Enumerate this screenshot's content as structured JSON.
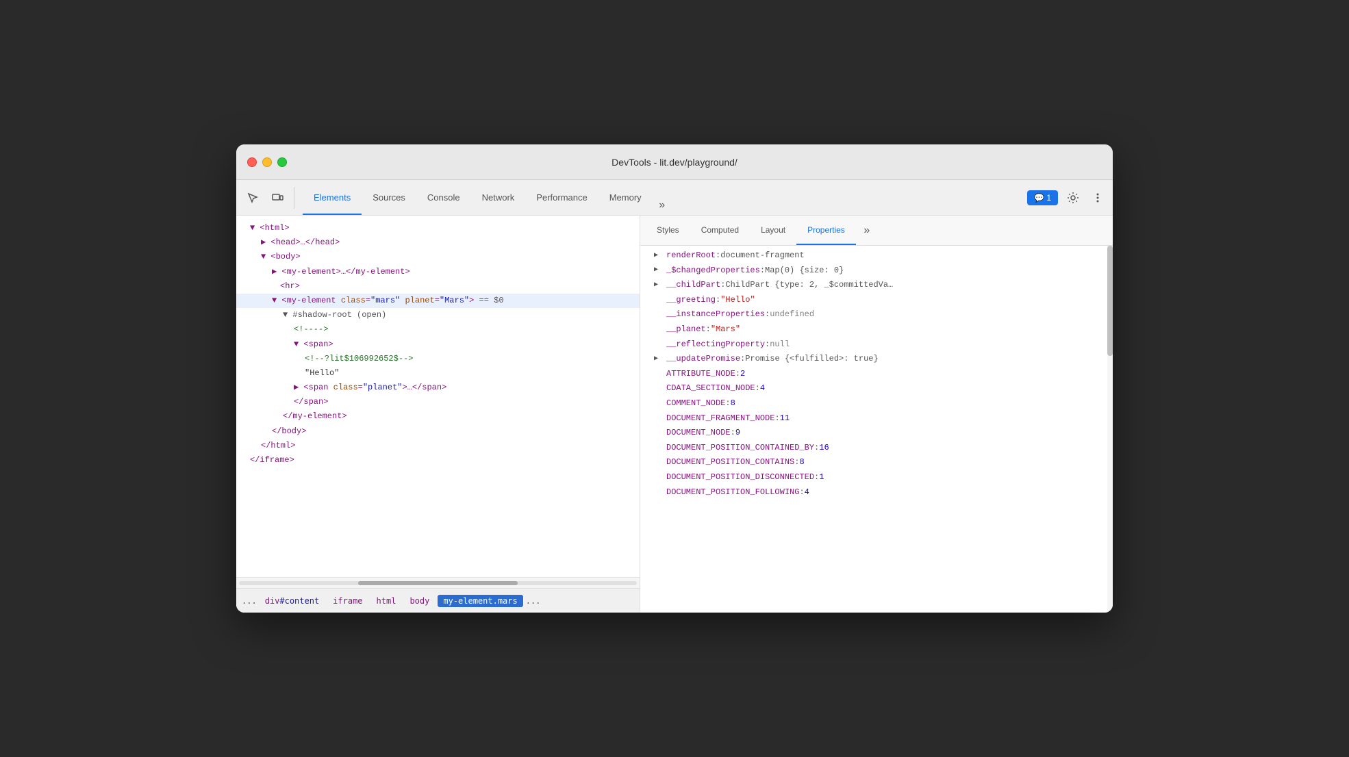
{
  "window": {
    "title": "DevTools - lit.dev/playground/"
  },
  "toolbar": {
    "tabs": [
      {
        "label": "Elements",
        "active": true
      },
      {
        "label": "Sources",
        "active": false
      },
      {
        "label": "Console",
        "active": false
      },
      {
        "label": "Network",
        "active": false
      },
      {
        "label": "Performance",
        "active": false
      },
      {
        "label": "Memory",
        "active": false
      }
    ],
    "more_tabs_label": "»",
    "notification_label": "💬 1",
    "settings_label": "⚙",
    "menu_label": "⋮"
  },
  "elements_panel": {
    "tree": [
      {
        "indent": 1,
        "content": "▼ <html>",
        "type": "tag"
      },
      {
        "indent": 2,
        "content": "▶ <head>…</head>",
        "type": "tag"
      },
      {
        "indent": 2,
        "content": "▼ <body>",
        "type": "tag"
      },
      {
        "indent": 3,
        "content": "▶ <my-element>…</my-element>",
        "type": "tag"
      },
      {
        "indent": 3,
        "content": "<hr>",
        "type": "tag"
      },
      {
        "indent": 3,
        "content": "▼ <my-element class=\"mars\" planet=\"Mars\"> == $0",
        "type": "selected"
      },
      {
        "indent": 4,
        "content": "▼ #shadow-root (open)",
        "type": "shadow"
      },
      {
        "indent": 5,
        "content": "<!---->",
        "type": "comment"
      },
      {
        "indent": 5,
        "content": "▼ <span>",
        "type": "tag"
      },
      {
        "indent": 6,
        "content": "<!--?lit$106992652$-->",
        "type": "comment"
      },
      {
        "indent": 6,
        "content": "\"Hello\"",
        "type": "text"
      },
      {
        "indent": 5,
        "content": "▶ <span class=\"planet\">…</span>",
        "type": "tag"
      },
      {
        "indent": 5,
        "content": "</span>",
        "type": "tag"
      },
      {
        "indent": 4,
        "content": "</my-element>",
        "type": "tag"
      },
      {
        "indent": 3,
        "content": "</body>",
        "type": "tag"
      },
      {
        "indent": 2,
        "content": "</html>",
        "type": "tag"
      },
      {
        "indent": 1,
        "content": "</iframe>",
        "type": "tag"
      }
    ],
    "breadcrumb": [
      {
        "label": "...",
        "type": "more"
      },
      {
        "label": "div#content",
        "active": false
      },
      {
        "label": "iframe",
        "active": false
      },
      {
        "label": "html",
        "active": false
      },
      {
        "label": "body",
        "active": false
      },
      {
        "label": "my-element.mars",
        "active": true
      },
      {
        "label": "...",
        "type": "more"
      }
    ]
  },
  "properties_panel": {
    "tabs": [
      {
        "label": "Styles",
        "active": false
      },
      {
        "label": "Computed",
        "active": false
      },
      {
        "label": "Layout",
        "active": false
      },
      {
        "label": "Properties",
        "active": true
      }
    ],
    "properties": [
      {
        "key": "renderRoot",
        "colon": ":",
        "value": "document-fragment",
        "value_type": "object",
        "has_arrow": true,
        "arrow_open": false
      },
      {
        "key": "_$changedProperties",
        "colon": ":",
        "value": "Map(0) {size: 0}",
        "value_type": "object",
        "has_arrow": true,
        "arrow_open": false
      },
      {
        "key": "__childPart",
        "colon": ":",
        "value": "ChildPart {type: 2, _$committedVa…",
        "value_type": "object",
        "has_arrow": true,
        "arrow_open": false
      },
      {
        "key": "__greeting",
        "colon": ":",
        "value": "\"Hello\"",
        "value_type": "string",
        "has_arrow": false
      },
      {
        "key": "__instanceProperties",
        "colon": ":",
        "value": "undefined",
        "value_type": "null",
        "has_arrow": false
      },
      {
        "key": "__planet",
        "colon": ":",
        "value": "\"Mars\"",
        "value_type": "string",
        "has_arrow": false
      },
      {
        "key": "__reflectingProperty",
        "colon": ":",
        "value": "null",
        "value_type": "null",
        "has_arrow": false
      },
      {
        "key": "__updatePromise",
        "colon": ":",
        "value": "Promise {<fulfilled>: true}",
        "value_type": "object",
        "has_arrow": true,
        "arrow_open": false
      },
      {
        "key": "ATTRIBUTE_NODE",
        "colon": ":",
        "value": "2",
        "value_type": "number",
        "has_arrow": false
      },
      {
        "key": "CDATA_SECTION_NODE",
        "colon": ":",
        "value": "4",
        "value_type": "number",
        "has_arrow": false
      },
      {
        "key": "COMMENT_NODE",
        "colon": ":",
        "value": "8",
        "value_type": "number",
        "has_arrow": false
      },
      {
        "key": "DOCUMENT_FRAGMENT_NODE",
        "colon": ":",
        "value": "11",
        "value_type": "number",
        "has_arrow": false
      },
      {
        "key": "DOCUMENT_NODE",
        "colon": ":",
        "value": "9",
        "value_type": "number",
        "has_arrow": false
      },
      {
        "key": "DOCUMENT_POSITION_CONTAINED_BY",
        "colon": ":",
        "value": "16",
        "value_type": "number",
        "has_arrow": false
      },
      {
        "key": "DOCUMENT_POSITION_CONTAINS",
        "colon": ":",
        "value": "8",
        "value_type": "number",
        "has_arrow": false
      },
      {
        "key": "DOCUMENT_POSITION_DISCONNECTED",
        "colon": ":",
        "value": "1",
        "value_type": "number",
        "has_arrow": false
      },
      {
        "key": "DOCUMENT_POSITION_FOLLOWING",
        "colon": ":",
        "value": "4",
        "value_type": "number",
        "has_arrow": false
      }
    ]
  },
  "colors": {
    "accent": "#1a73e8",
    "tag": "#881280",
    "attr_name": "#994500",
    "attr_value": "#1a1aa6",
    "comment": "#236e25",
    "string_value": "#c41a16",
    "number_value": "#1c00cf"
  }
}
